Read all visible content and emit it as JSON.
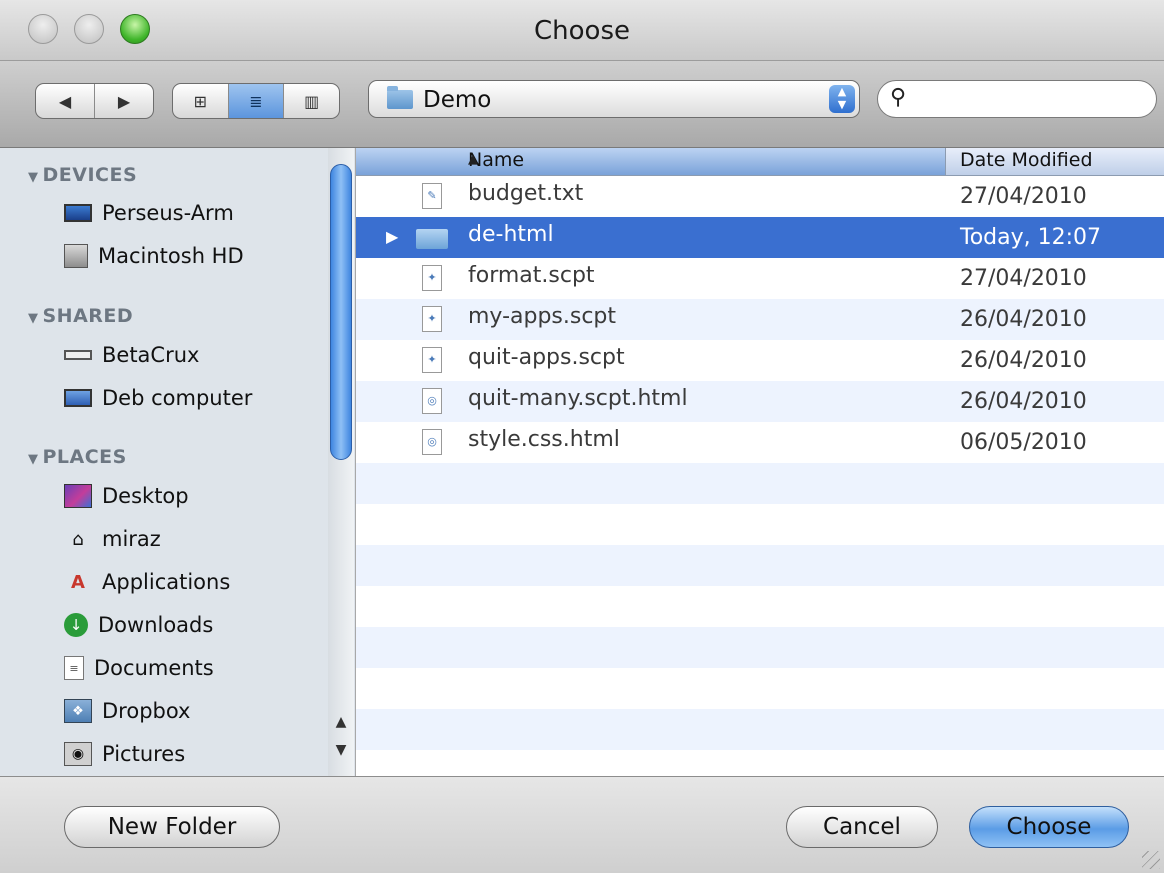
{
  "window": {
    "title": "Choose"
  },
  "toolbar": {
    "back_label": "◀",
    "forward_label": "▶",
    "view_icon": "⊞",
    "view_list": "≣",
    "view_columns": "▥",
    "location": "Demo",
    "search": {
      "value": "",
      "placeholder": ""
    }
  },
  "sidebar": {
    "devices_label": "DEVICES",
    "shared_label": "SHARED",
    "places_label": "PLACES",
    "devices": [
      {
        "label": "Perseus-Arm",
        "icon": "laptop-icon"
      },
      {
        "label": "Macintosh HD",
        "icon": "hard-drive-icon"
      }
    ],
    "shared": [
      {
        "label": "BetaCrux",
        "icon": "server-icon"
      },
      {
        "label": "Deb computer",
        "icon": "monitor-icon"
      }
    ],
    "places": [
      {
        "label": "Desktop",
        "icon": "desktop-icon"
      },
      {
        "label": "miraz",
        "icon": "home-icon"
      },
      {
        "label": "Applications",
        "icon": "applications-icon"
      },
      {
        "label": "Downloads",
        "icon": "downloads-icon"
      },
      {
        "label": "Documents",
        "icon": "documents-icon"
      },
      {
        "label": "Dropbox",
        "icon": "dropbox-icon"
      },
      {
        "label": "Pictures",
        "icon": "pictures-icon"
      }
    ]
  },
  "filelist": {
    "col_name": "Name",
    "col_date": "Date Modified",
    "rows": [
      {
        "name": "budget.txt",
        "date": "27/04/2010",
        "kind": "text"
      },
      {
        "name": "de-html",
        "date": "Today, 12:07",
        "kind": "folder",
        "selected": true
      },
      {
        "name": "format.scpt",
        "date": "27/04/2010",
        "kind": "script"
      },
      {
        "name": "my-apps.scpt",
        "date": "26/04/2010",
        "kind": "script"
      },
      {
        "name": "quit-apps.scpt",
        "date": "26/04/2010",
        "kind": "script"
      },
      {
        "name": "quit-many.scpt.html",
        "date": "26/04/2010",
        "kind": "html"
      },
      {
        "name": "style.css.html",
        "date": "06/05/2010",
        "kind": "html"
      }
    ]
  },
  "buttons": {
    "new_folder": "New Folder",
    "cancel": "Cancel",
    "choose": "Choose"
  },
  "colors": {
    "selection": "#3a6fd0",
    "row_alt": "#edf3fe",
    "sidebar_bg": "#dee4ea",
    "default_button": "#5b9ce6"
  }
}
